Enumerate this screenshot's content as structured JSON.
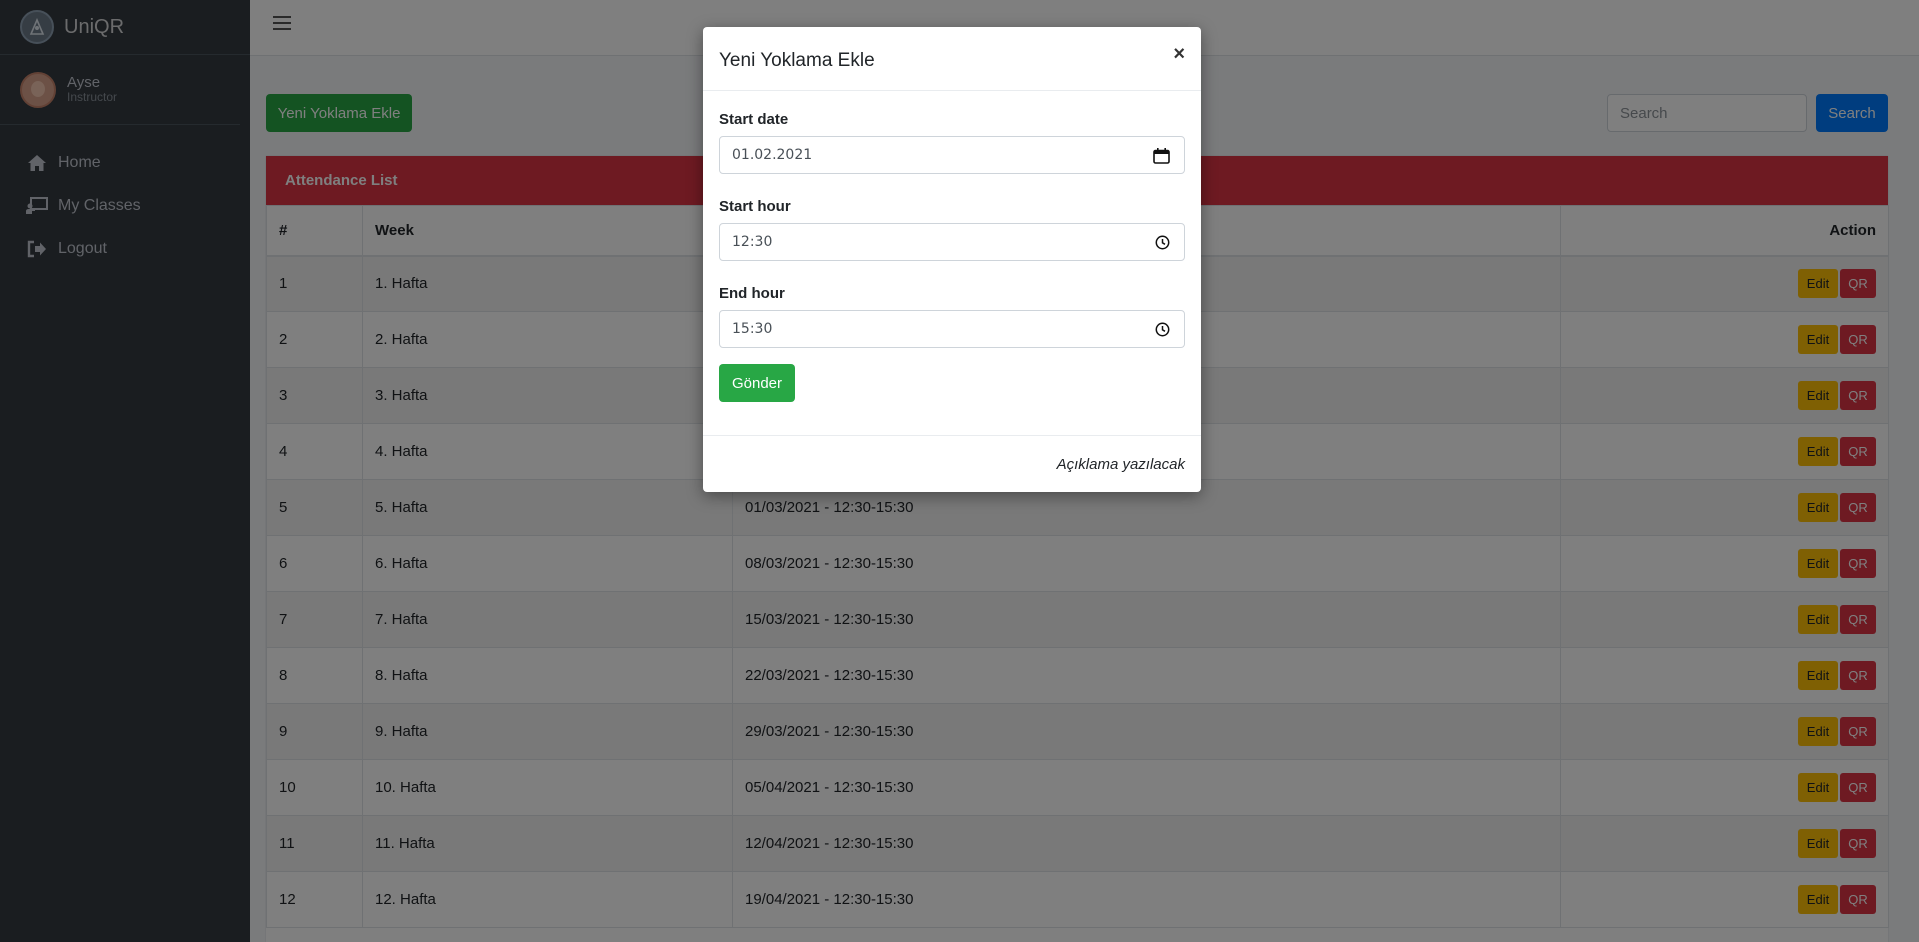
{
  "brand": {
    "name": "UniQR"
  },
  "user": {
    "name": "Ayse",
    "role": "Instructor"
  },
  "nav": [
    {
      "label": "Home",
      "icon": "home-icon"
    },
    {
      "label": "My Classes",
      "icon": "chalkboard-icon"
    },
    {
      "label": "Logout",
      "icon": "logout-icon"
    }
  ],
  "toolbar": {
    "add_label": "Yeni Yoklama Ekle",
    "search_placeholder": "Search",
    "search_label": "Search"
  },
  "card": {
    "title": "Attendance List"
  },
  "table": {
    "headers": [
      "#",
      "Week",
      "",
      "Action"
    ],
    "rows": [
      {
        "n": "1",
        "week": "1. Hafta",
        "date": ""
      },
      {
        "n": "2",
        "week": "2. Hafta",
        "date": ""
      },
      {
        "n": "3",
        "week": "3. Hafta",
        "date": ""
      },
      {
        "n": "4",
        "week": "4. Hafta",
        "date": ""
      },
      {
        "n": "5",
        "week": "5. Hafta",
        "date": "01/03/2021 - 12:30-15:30"
      },
      {
        "n": "6",
        "week": "6. Hafta",
        "date": "08/03/2021 - 12:30-15:30"
      },
      {
        "n": "7",
        "week": "7. Hafta",
        "date": "15/03/2021 - 12:30-15:30"
      },
      {
        "n": "8",
        "week": "8. Hafta",
        "date": "22/03/2021 - 12:30-15:30"
      },
      {
        "n": "9",
        "week": "9. Hafta",
        "date": "29/03/2021 - 12:30-15:30"
      },
      {
        "n": "10",
        "week": "10. Hafta",
        "date": "05/04/2021 - 12:30-15:30"
      },
      {
        "n": "11",
        "week": "11. Hafta",
        "date": "12/04/2021 - 12:30-15:30"
      },
      {
        "n": "12",
        "week": "12. Hafta",
        "date": "19/04/2021 - 12:30-15:30"
      }
    ],
    "edit_label": "Edit",
    "qr_label": "QR"
  },
  "modal": {
    "title": "Yeni Yoklama Ekle",
    "close": "×",
    "start_date_label": "Start date",
    "start_date_value": "01.02.2021",
    "start_hour_label": "Start hour",
    "start_hour_value": "12:30",
    "end_hour_label": "End hour",
    "end_hour_value": "15:30",
    "submit_label": "Gönder",
    "footer_text": "Açıklama yazılacak"
  },
  "colors": {
    "sidebar": "#343a40",
    "success": "#28a745",
    "danger": "#dc3545",
    "primary": "#007bff",
    "warning": "#ffc107"
  }
}
